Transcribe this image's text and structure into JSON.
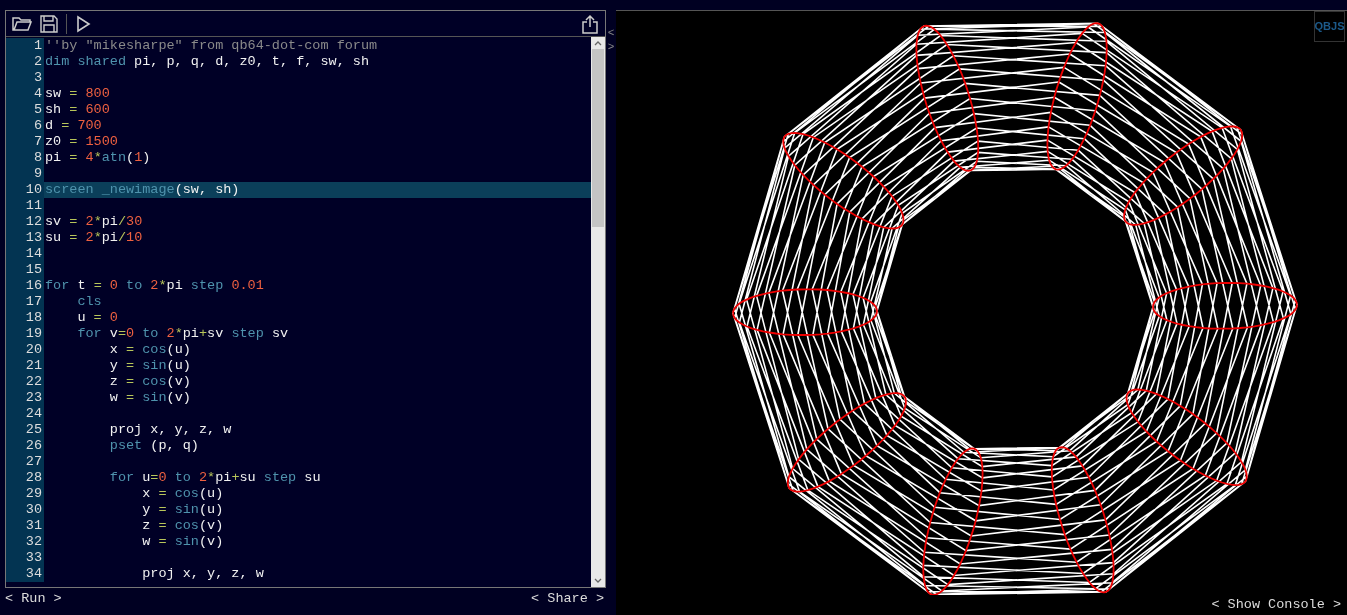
{
  "editor": {
    "lines": [
      {
        "number": "1",
        "selected": false,
        "tokens": [
          {
            "kind": "comment",
            "text": "''by \"mikesharpe\" from qb64-dot-com forum"
          }
        ]
      },
      {
        "number": "2",
        "selected": false,
        "tokens": [
          {
            "kind": "keyword",
            "text": "dim shared"
          },
          {
            "kind": "ident",
            "text": " pi, p, q, d, z0, t, f, sw, sh"
          }
        ]
      },
      {
        "number": "3",
        "selected": false
      },
      {
        "number": "4",
        "selected": false,
        "tokens": [
          {
            "kind": "ident",
            "text": "sw "
          },
          {
            "kind": "op",
            "text": "="
          },
          {
            "kind": "number",
            "text": " 800"
          }
        ]
      },
      {
        "number": "5",
        "selected": false,
        "tokens": [
          {
            "kind": "ident",
            "text": "sh "
          },
          {
            "kind": "op",
            "text": "="
          },
          {
            "kind": "number",
            "text": " 600"
          }
        ]
      },
      {
        "number": "6",
        "selected": false,
        "tokens": [
          {
            "kind": "ident",
            "text": "d "
          },
          {
            "kind": "op",
            "text": "="
          },
          {
            "kind": "number",
            "text": " 700"
          }
        ]
      },
      {
        "number": "7",
        "selected": false,
        "tokens": [
          {
            "kind": "ident",
            "text": "z0 "
          },
          {
            "kind": "op",
            "text": "="
          },
          {
            "kind": "number",
            "text": " 1500"
          }
        ]
      },
      {
        "number": "8",
        "selected": false,
        "tokens": [
          {
            "kind": "ident",
            "text": "pi "
          },
          {
            "kind": "op",
            "text": "="
          },
          {
            "kind": "number",
            "text": " 4"
          },
          {
            "kind": "op",
            "text": "*"
          },
          {
            "kind": "keyword",
            "text": "atn"
          },
          {
            "kind": "ident",
            "text": "("
          },
          {
            "kind": "number",
            "text": "1"
          },
          {
            "kind": "ident",
            "text": ")"
          }
        ]
      },
      {
        "number": "9",
        "selected": false
      },
      {
        "number": "10",
        "selected": true,
        "tokens": [
          {
            "kind": "keyword",
            "text": "screen _newimage"
          },
          {
            "kind": "ident",
            "text": "(sw, sh)"
          }
        ]
      },
      {
        "number": "11",
        "selected": false
      },
      {
        "number": "12",
        "selected": false,
        "tokens": [
          {
            "kind": "ident",
            "text": "sv "
          },
          {
            "kind": "op",
            "text": "="
          },
          {
            "kind": "number",
            "text": " 2"
          },
          {
            "kind": "op",
            "text": "*"
          },
          {
            "kind": "ident",
            "text": "pi"
          },
          {
            "kind": "op",
            "text": "/"
          },
          {
            "kind": "number",
            "text": "30"
          }
        ]
      },
      {
        "number": "13",
        "selected": false,
        "tokens": [
          {
            "kind": "ident",
            "text": "su "
          },
          {
            "kind": "op",
            "text": "="
          },
          {
            "kind": "number",
            "text": " 2"
          },
          {
            "kind": "op",
            "text": "*"
          },
          {
            "kind": "ident",
            "text": "pi"
          },
          {
            "kind": "op",
            "text": "/"
          },
          {
            "kind": "number",
            "text": "10"
          }
        ]
      },
      {
        "number": "14",
        "selected": false
      },
      {
        "number": "15",
        "selected": false
      },
      {
        "number": "16",
        "selected": false,
        "tokens": [
          {
            "kind": "keyword",
            "text": "for"
          },
          {
            "kind": "ident",
            "text": " t "
          },
          {
            "kind": "op",
            "text": "="
          },
          {
            "kind": "number",
            "text": " 0"
          },
          {
            "kind": "keyword",
            "text": " to"
          },
          {
            "kind": "number",
            "text": " 2"
          },
          {
            "kind": "op",
            "text": "*"
          },
          {
            "kind": "ident",
            "text": "pi"
          },
          {
            "kind": "keyword",
            "text": " step"
          },
          {
            "kind": "number",
            "text": " 0.01"
          }
        ]
      },
      {
        "number": "17",
        "selected": false,
        "tokens": [
          {
            "kind": "keyword",
            "text": "    cls"
          }
        ]
      },
      {
        "number": "18",
        "selected": false,
        "tokens": [
          {
            "kind": "ident",
            "text": "    u "
          },
          {
            "kind": "op",
            "text": "="
          },
          {
            "kind": "number",
            "text": " 0"
          }
        ]
      },
      {
        "number": "19",
        "selected": false,
        "tokens": [
          {
            "kind": "keyword",
            "text": "    for"
          },
          {
            "kind": "ident",
            "text": " v"
          },
          {
            "kind": "op",
            "text": "="
          },
          {
            "kind": "number",
            "text": "0"
          },
          {
            "kind": "keyword",
            "text": " to"
          },
          {
            "kind": "number",
            "text": " 2"
          },
          {
            "kind": "op",
            "text": "*"
          },
          {
            "kind": "ident",
            "text": "pi"
          },
          {
            "kind": "op",
            "text": "+"
          },
          {
            "kind": "ident",
            "text": "sv"
          },
          {
            "kind": "keyword",
            "text": " step"
          },
          {
            "kind": "ident",
            "text": " sv"
          }
        ]
      },
      {
        "number": "20",
        "selected": false,
        "tokens": [
          {
            "kind": "ident",
            "text": "        x "
          },
          {
            "kind": "op",
            "text": "="
          },
          {
            "kind": "keyword",
            "text": " cos"
          },
          {
            "kind": "ident",
            "text": "(u)"
          }
        ]
      },
      {
        "number": "21",
        "selected": false,
        "tokens": [
          {
            "kind": "ident",
            "text": "        y "
          },
          {
            "kind": "op",
            "text": "="
          },
          {
            "kind": "keyword",
            "text": " sin"
          },
          {
            "kind": "ident",
            "text": "(u)"
          }
        ]
      },
      {
        "number": "22",
        "selected": false,
        "tokens": [
          {
            "kind": "ident",
            "text": "        z "
          },
          {
            "kind": "op",
            "text": "="
          },
          {
            "kind": "keyword",
            "text": " cos"
          },
          {
            "kind": "ident",
            "text": "(v)"
          }
        ]
      },
      {
        "number": "23",
        "selected": false,
        "tokens": [
          {
            "kind": "ident",
            "text": "        w "
          },
          {
            "kind": "op",
            "text": "="
          },
          {
            "kind": "keyword",
            "text": " sin"
          },
          {
            "kind": "ident",
            "text": "(v)"
          }
        ]
      },
      {
        "number": "24",
        "selected": false
      },
      {
        "number": "25",
        "selected": false,
        "tokens": [
          {
            "kind": "ident",
            "text": "        proj x, y, z, w"
          }
        ]
      },
      {
        "number": "26",
        "selected": false,
        "tokens": [
          {
            "kind": "keyword",
            "text": "        pset"
          },
          {
            "kind": "ident",
            "text": " (p, q)"
          }
        ]
      },
      {
        "number": "27",
        "selected": false
      },
      {
        "number": "28",
        "selected": false,
        "tokens": [
          {
            "kind": "keyword",
            "text": "        for"
          },
          {
            "kind": "ident",
            "text": " u"
          },
          {
            "kind": "op",
            "text": "="
          },
          {
            "kind": "number",
            "text": "0"
          },
          {
            "kind": "keyword",
            "text": " to"
          },
          {
            "kind": "number",
            "text": " 2"
          },
          {
            "kind": "op",
            "text": "*"
          },
          {
            "kind": "ident",
            "text": "pi"
          },
          {
            "kind": "op",
            "text": "+"
          },
          {
            "kind": "ident",
            "text": "su"
          },
          {
            "kind": "keyword",
            "text": " step"
          },
          {
            "kind": "ident",
            "text": " su"
          }
        ]
      },
      {
        "number": "29",
        "selected": false,
        "tokens": [
          {
            "kind": "ident",
            "text": "            x "
          },
          {
            "kind": "op",
            "text": "="
          },
          {
            "kind": "keyword",
            "text": " cos"
          },
          {
            "kind": "ident",
            "text": "(u)"
          }
        ]
      },
      {
        "number": "30",
        "selected": false,
        "tokens": [
          {
            "kind": "ident",
            "text": "            y "
          },
          {
            "kind": "op",
            "text": "="
          },
          {
            "kind": "keyword",
            "text": " sin"
          },
          {
            "kind": "ident",
            "text": "(u)"
          }
        ]
      },
      {
        "number": "31",
        "selected": false,
        "tokens": [
          {
            "kind": "ident",
            "text": "            z "
          },
          {
            "kind": "op",
            "text": "="
          },
          {
            "kind": "keyword",
            "text": " cos"
          },
          {
            "kind": "ident",
            "text": "(v)"
          }
        ]
      },
      {
        "number": "32",
        "selected": false,
        "tokens": [
          {
            "kind": "ident",
            "text": "            w "
          },
          {
            "kind": "op",
            "text": "="
          },
          {
            "kind": "keyword",
            "text": " sin"
          },
          {
            "kind": "ident",
            "text": "(v)"
          }
        ]
      },
      {
        "number": "33",
        "selected": false
      },
      {
        "number": "34",
        "selected": false,
        "tokens": [
          {
            "kind": "ident",
            "text": "            proj x, y, z, w"
          }
        ]
      }
    ]
  },
  "splitter": {
    "collapse": "<",
    "expand": ">"
  },
  "bottom_bar": {
    "run": "< Run >",
    "share": "< Share >"
  },
  "output": {
    "logo": "QBJS",
    "console_button": "< Show Console >"
  }
}
